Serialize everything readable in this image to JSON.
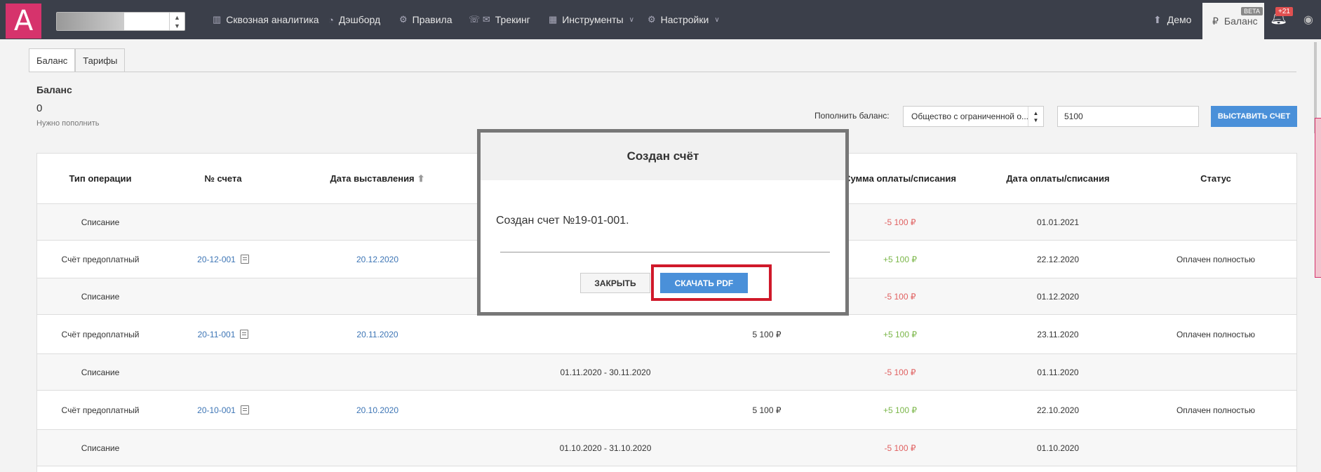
{
  "topbar": {
    "logo": "A",
    "nav": [
      {
        "label": "Сквозная аналитика",
        "icon": "bar-chart-icon"
      },
      {
        "label": "Дэшборд",
        "icon": "gauge-icon"
      },
      {
        "label": "Правила",
        "icon": "gears-icon"
      },
      {
        "label": "Трекинг",
        "icon": "phone-mail-icon"
      },
      {
        "label": "Инструменты",
        "icon": "grid-icon",
        "dropdown": true
      },
      {
        "label": "Настройки",
        "icon": "gear-icon",
        "dropdown": true
      }
    ],
    "demo": "Демо",
    "balance": "Баланс",
    "beta": "BETA",
    "notifications": "+21"
  },
  "tabs": [
    "Баланс",
    "Тарифы"
  ],
  "balance": {
    "title": "Баланс",
    "value": "0",
    "hint": "Нужно пополнить"
  },
  "topup": {
    "label": "Пополнить баланс:",
    "org": "Общество с ограниченной о...",
    "amount": "5100",
    "button": "ВЫСТАВИТЬ СЧЕТ"
  },
  "table": {
    "headers": [
      "Тип операции",
      "№ счета",
      "Дата выставления",
      "Сумма оплаты/списания",
      "Дата оплаты/списания",
      "Статус"
    ],
    "rows": [
      {
        "type": "Списание",
        "num": "",
        "issued": "",
        "period": "",
        "sum": "",
        "amount": "-5 100 ₽",
        "date": "01.01.2021",
        "status": ""
      },
      {
        "type": "Счёт предоплатный",
        "num": "20-12-001",
        "issued": "20.12.2020",
        "period": "",
        "sum": "",
        "amount": "+5 100 ₽",
        "date": "22.12.2020",
        "status": "Оплачен полностью"
      },
      {
        "type": "Списание",
        "num": "",
        "issued": "",
        "period": "",
        "sum": "",
        "amount": "-5 100 ₽",
        "date": "01.12.2020",
        "status": ""
      },
      {
        "type": "Счёт предоплатный",
        "num": "20-11-001",
        "issued": "20.11.2020",
        "period": "",
        "sum": "5 100 ₽",
        "amount": "+5 100 ₽",
        "date": "23.11.2020",
        "status": "Оплачен полностью"
      },
      {
        "type": "Списание",
        "num": "",
        "issued": "",
        "period": "01.11.2020 - 30.11.2020",
        "sum": "",
        "amount": "-5 100 ₽",
        "date": "01.11.2020",
        "status": ""
      },
      {
        "type": "Счёт предоплатный",
        "num": "20-10-001",
        "issued": "20.10.2020",
        "period": "",
        "sum": "5 100 ₽",
        "amount": "+5 100 ₽",
        "date": "22.10.2020",
        "status": "Оплачен полностью"
      },
      {
        "type": "Списание",
        "num": "",
        "issued": "",
        "period": "01.10.2020 - 31.10.2020",
        "sum": "",
        "amount": "-5 100 ₽",
        "date": "01.10.2020",
        "status": ""
      }
    ]
  },
  "modal": {
    "title": "Создан счёт",
    "text": "Создан счет №19-01-001.",
    "close": "ЗАКРЫТЬ",
    "pdf": "СКАЧАТЬ PDF"
  }
}
